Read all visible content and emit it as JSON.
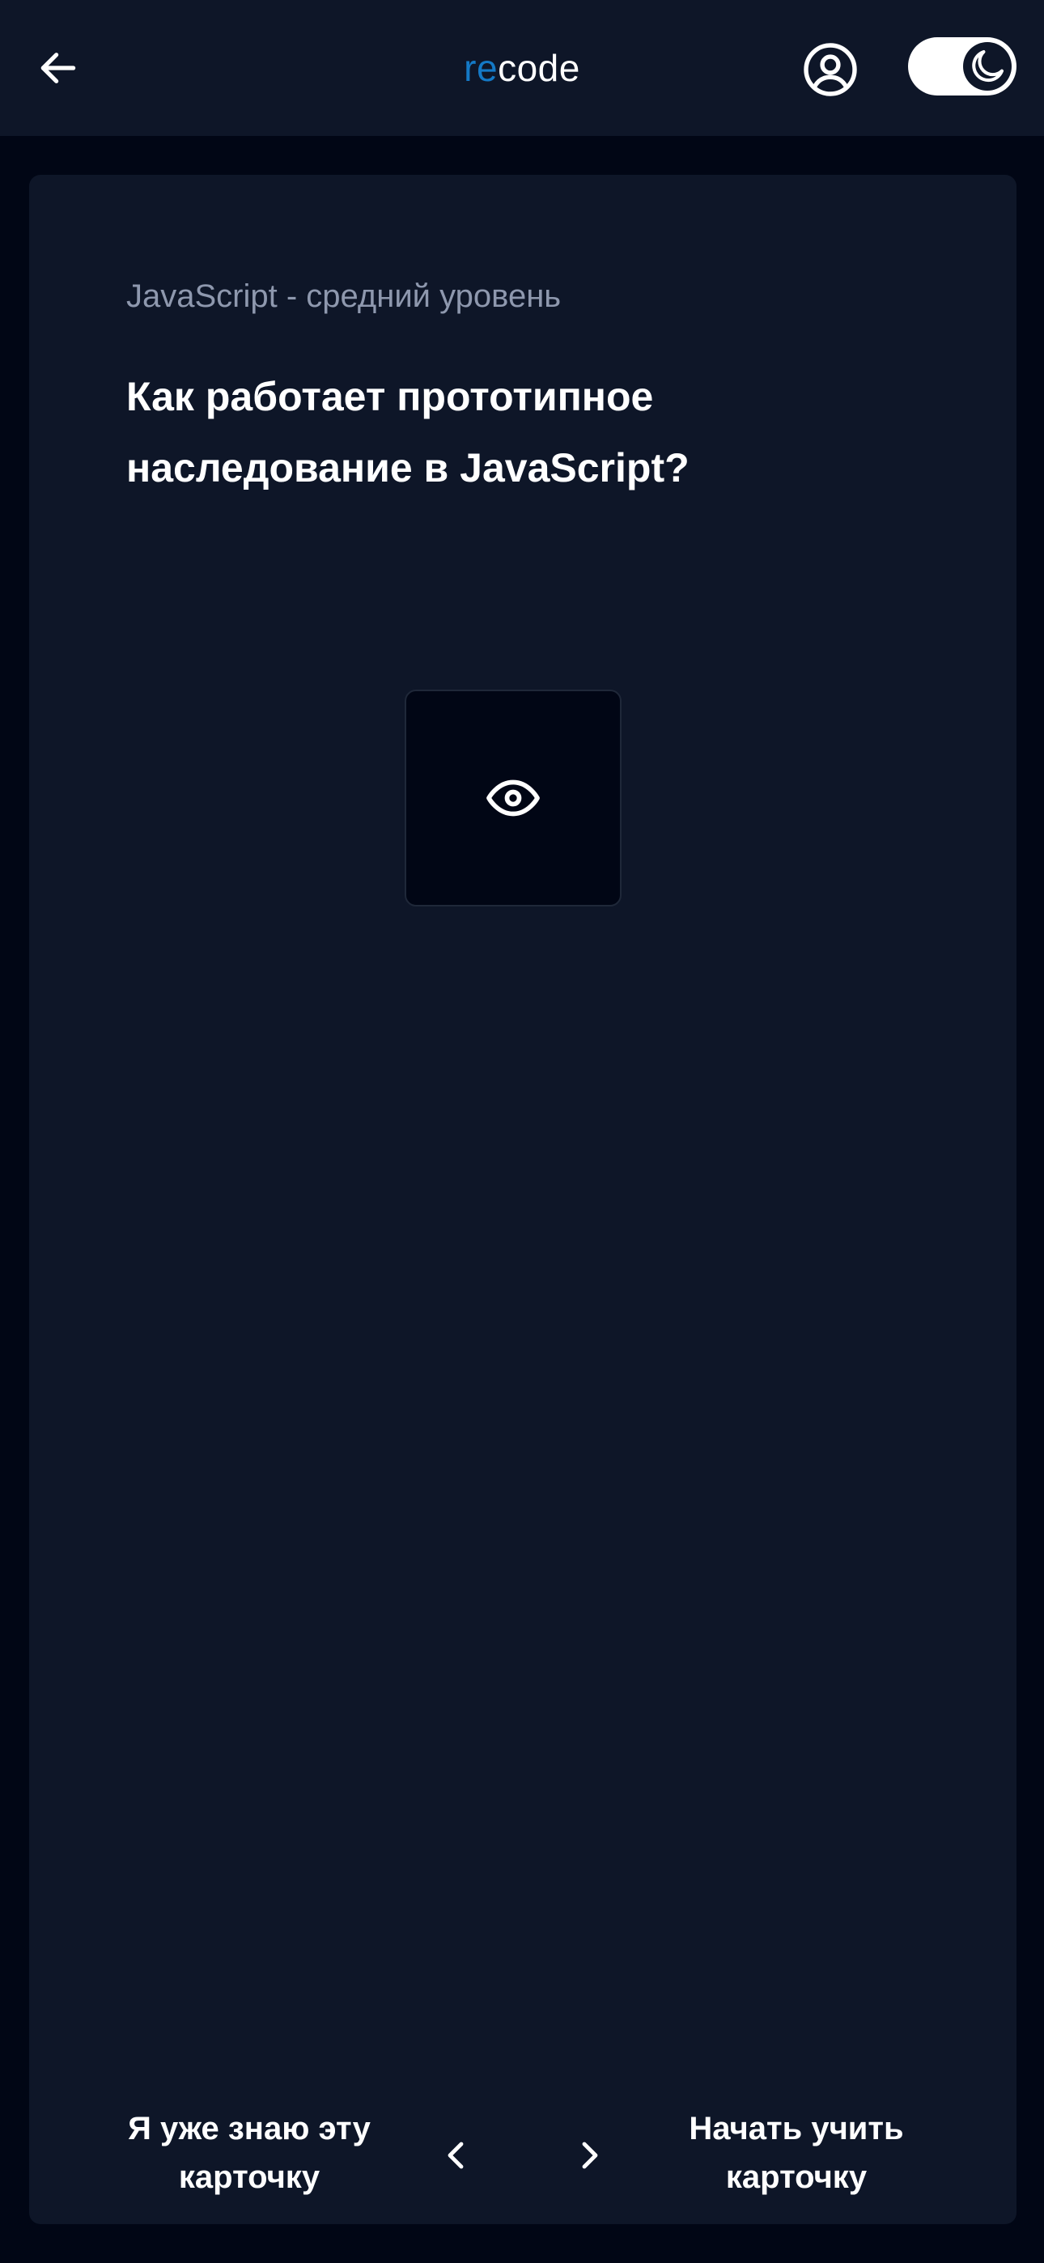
{
  "header": {
    "logo_accent": "re",
    "logo_rest": "code",
    "back_icon": "arrow-left-icon",
    "profile_icon": "user-circle-icon",
    "theme_icon": "moon-icon"
  },
  "card": {
    "category": "JavaScript - средний уровень",
    "question": "Как работает прототипное наследование в JavaScript?",
    "reveal_icon": "eye-icon",
    "known_label": "Я уже знаю эту карточку",
    "learn_label": "Начать учить карточку",
    "prev_icon": "chevron-left-icon",
    "next_icon": "chevron-right-icon"
  },
  "colors": {
    "page_bg": "#010615",
    "surface": "#0e1628",
    "accent": "#1479c6",
    "muted_text": "#8e98ae"
  }
}
